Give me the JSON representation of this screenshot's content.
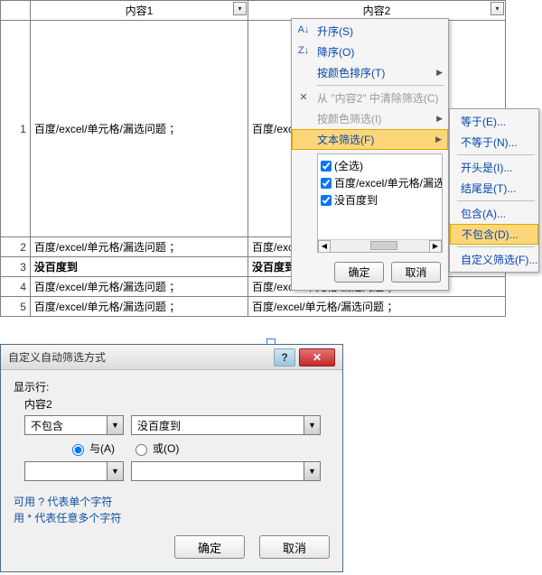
{
  "sheet": {
    "headers": {
      "content1": "内容1",
      "content2": "内容2"
    },
    "rows": [
      {
        "num": "1",
        "c1": "百度/excel/单元格/漏选问题 ；",
        "c2": "百度/excel/单元格/漏选问题 ；百度/excel/单元格/漏选问题 ；百度/excel/单元格/漏选问题 ；百度/excel/单元格/漏选问题 ；百度/excel/单元格/漏选问题 ；百度/excel/单元格/漏选问题 ；百度/excel/单元格/漏选问题 ；百度/excel/单元格/漏选问题 ；百度/excel/单元格/漏选问题 ；百度/excel/单元格/漏选问题 ；百度/excel/单元格/漏选问题 ；百度/excel/单元格/漏选问题 ；百度/excel/单元格/漏选问题 ；百度/excel/单元格/漏选问题 ；百度/excel/单元格/漏选问题"
      },
      {
        "num": "2",
        "c1": "百度/excel/单元格/漏选问题 ；",
        "c2": "百度/excel"
      },
      {
        "num": "3",
        "c1": "没百度到",
        "c2": "没百度到"
      },
      {
        "num": "4",
        "c1": "百度/excel/单元格/漏选问题 ；",
        "c2": "百度/excel/单元格/漏选问题 ；"
      },
      {
        "num": "5",
        "c1": "百度/excel/单元格/漏选问题 ；",
        "c2": "百度/excel/单元格/漏选问题 ；"
      }
    ]
  },
  "ctx": {
    "sort_asc": "升序(S)",
    "sort_desc": "降序(O)",
    "sort_by_color": "按颜色排序(T)",
    "clear_filter": "从 \"内容2\" 中清除筛选(C)",
    "filter_by_color": "按颜色筛选(I)",
    "text_filter": "文本筛选(F)",
    "check_all": "(全选)",
    "check_opt1": "百度/excel/单元格/漏选问题",
    "check_opt2": "没百度到",
    "ok": "确定",
    "cancel": "取消"
  },
  "submenu": {
    "equals": "等于(E)...",
    "not_equals": "不等于(N)...",
    "begins_with": "开头是(I)...",
    "ends_with": "结尾是(T)...",
    "contains": "包含(A)...",
    "not_contains": "不包含(D)...",
    "custom": "自定义筛选(F)..."
  },
  "dialog": {
    "title": "自定义自动筛选方式",
    "show_rows": "显示行:",
    "field": "内容2",
    "op1": "不包含",
    "val1": "没百度到",
    "and": "与(A)",
    "or": "或(O)",
    "op2": "",
    "val2": "",
    "hint1": "可用 ? 代表单个字符",
    "hint2": "用 * 代表任意多个字符",
    "ok": "确定",
    "cancel": "取消"
  }
}
